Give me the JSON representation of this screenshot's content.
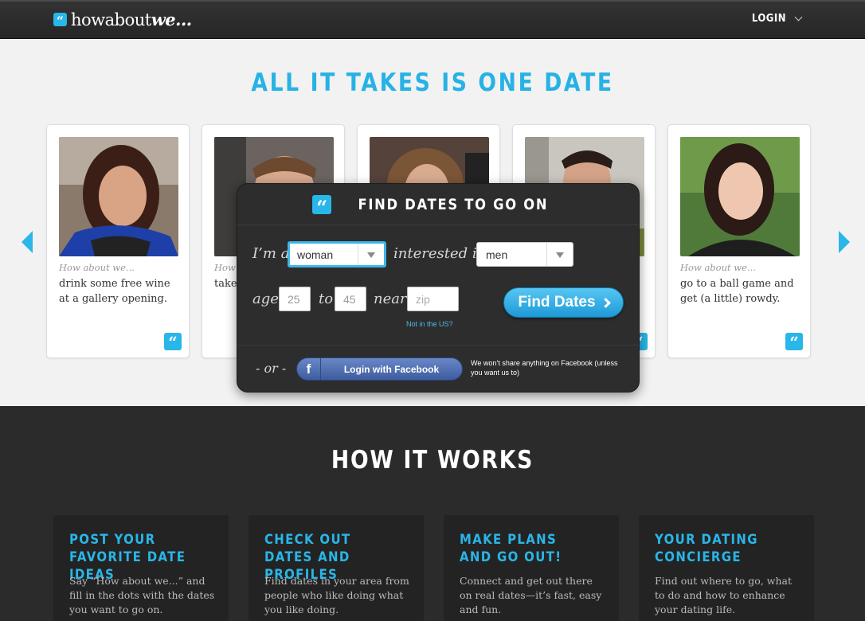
{
  "nav": {
    "logo_text_plain": "howabout",
    "logo_text_bold": "we...",
    "login_label": "LOGIN"
  },
  "hero": {
    "title": "ALL IT TAKES IS ONE DATE"
  },
  "cards": [
    {
      "prefix": "How about we...",
      "idea": "drink some free wine at a gallery opening."
    },
    {
      "prefix": "How",
      "idea": "take arou"
    },
    {
      "prefix": "",
      "idea": ""
    },
    {
      "prefix": "",
      "idea": ""
    },
    {
      "prefix": "How about we...",
      "idea": "go to a ball game and get (a little) rowdy."
    }
  ],
  "search": {
    "title": "FIND DATES TO GO ON",
    "im_a_label": "I’m a",
    "gender_value": "woman",
    "interested_label": "interested in",
    "interest_value": "men",
    "age_label": "age",
    "age_min": "25",
    "to_label": "to",
    "age_max": "45",
    "near_label": "near",
    "zip_placeholder": "zip",
    "not_us_link": "Not in the US?",
    "find_button": "Find Dates",
    "or_label": "- or -",
    "facebook_button": "Login with Facebook",
    "facebook_note": "We won’t share anything on Facebook (unless you want us to)"
  },
  "how": {
    "title": "HOW IT WORKS",
    "steps": [
      {
        "title": "POST YOUR FAVORITE DATE IDEAS",
        "desc": "Say “How about we...” and fill in the dots with the dates you want to go on."
      },
      {
        "title": "CHECK OUT DATES AND PROFILES",
        "desc": "Find dates in your area from people who like doing what you like doing."
      },
      {
        "title": "MAKE PLANS AND GO OUT!",
        "desc": "Connect and get out there on real dates—it’s fast, easy and fun."
      },
      {
        "title": "YOUR DATING CONCIERGE",
        "desc": "Find out where to go, what to do and how to enhance your dating life."
      }
    ]
  },
  "colors": {
    "accent": "#29b6e8",
    "dark": "#2b2b2b",
    "facebook": "#4d6db0"
  }
}
